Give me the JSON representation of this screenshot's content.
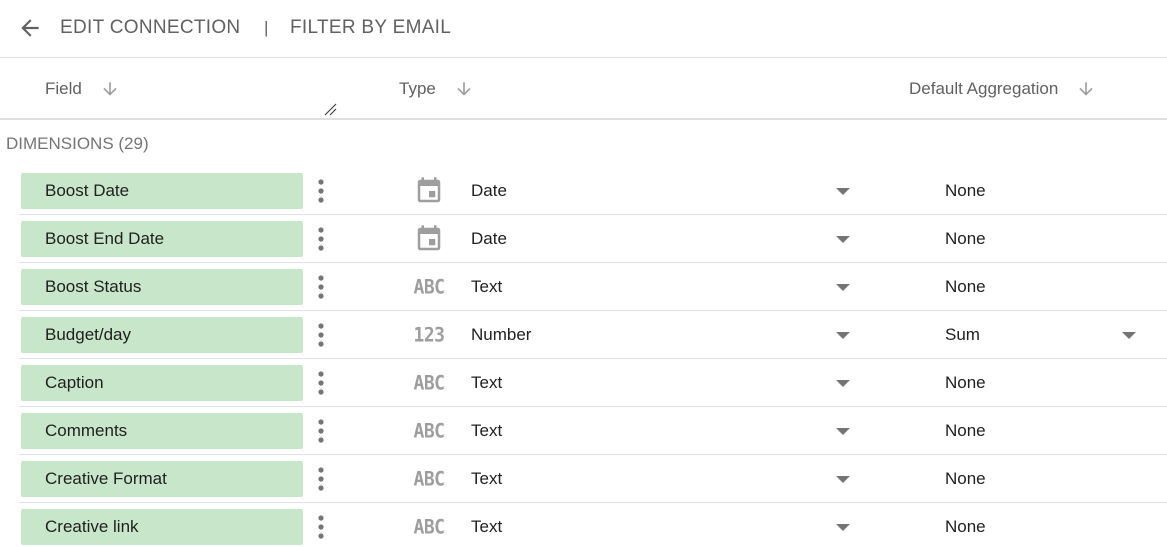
{
  "topbar": {
    "back_icon": "arrow-left-icon",
    "edit_connection": "EDIT CONNECTION",
    "separator": "|",
    "filter_by_email": "FILTER BY EMAIL"
  },
  "columns": {
    "field": "Field",
    "type": "Type",
    "default_aggregation": "Default Aggregation"
  },
  "section": {
    "title": "DIMENSIONS (29)"
  },
  "colors": {
    "chip": "#c8e6c9",
    "icon_gray": "#9e9e9e",
    "header_text": "#616161"
  },
  "rows": [
    {
      "field": "Boost Date",
      "type_icon": "calendar-icon",
      "type": "Date",
      "aggregation": "None",
      "aggregation_editable": false
    },
    {
      "field": "Boost End Date",
      "type_icon": "calendar-icon",
      "type": "Date",
      "aggregation": "None",
      "aggregation_editable": false
    },
    {
      "field": "Boost Status",
      "type_icon": "text-type-icon",
      "type_glyph": "ABC",
      "type": "Text",
      "aggregation": "None",
      "aggregation_editable": false
    },
    {
      "field": "Budget/day",
      "type_icon": "number-type-icon",
      "type_glyph": "123",
      "type": "Number",
      "aggregation": "Sum",
      "aggregation_editable": true
    },
    {
      "field": "Caption",
      "type_icon": "text-type-icon",
      "type_glyph": "ABC",
      "type": "Text",
      "aggregation": "None",
      "aggregation_editable": false
    },
    {
      "field": "Comments",
      "type_icon": "text-type-icon",
      "type_glyph": "ABC",
      "type": "Text",
      "aggregation": "None",
      "aggregation_editable": false
    },
    {
      "field": "Creative Format",
      "type_icon": "text-type-icon",
      "type_glyph": "ABC",
      "type": "Text",
      "aggregation": "None",
      "aggregation_editable": false
    },
    {
      "field": "Creative link",
      "type_icon": "text-type-icon",
      "type_glyph": "ABC",
      "type": "Text",
      "aggregation": "None",
      "aggregation_editable": false
    }
  ]
}
